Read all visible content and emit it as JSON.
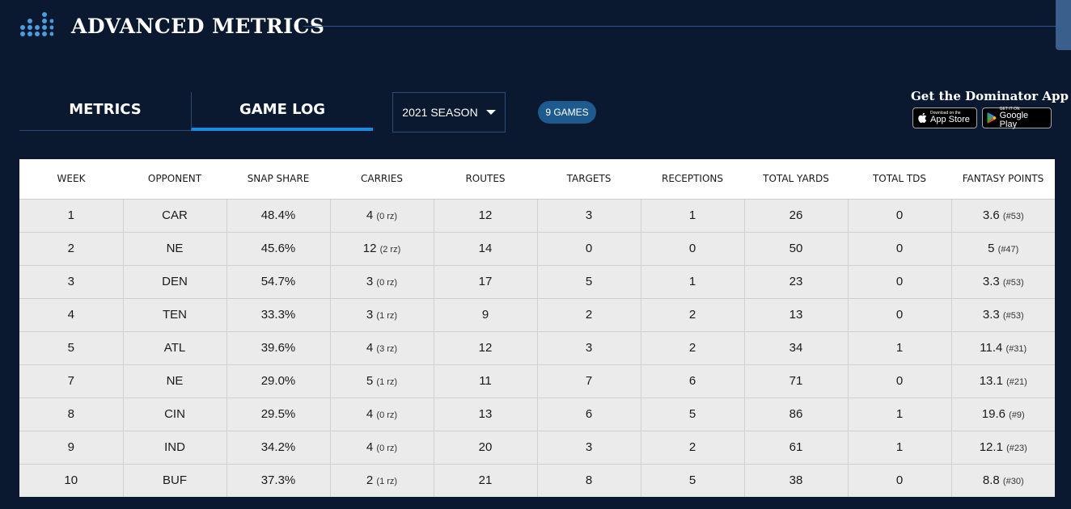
{
  "header": {
    "title": "ADVANCED METRICS",
    "logo_icon": "dot-grid-icon"
  },
  "tabs": [
    {
      "label": "METRICS",
      "active": false
    },
    {
      "label": "GAME LOG",
      "active": true
    }
  ],
  "season_select": {
    "value": "2021 SEASON"
  },
  "games_badge": "9 GAMES",
  "app_promo": {
    "title": "Get the Dominator App",
    "app_store": {
      "small": "Download on the",
      "big": "App Store"
    },
    "google_play": {
      "small": "GET IT ON",
      "big": "Google Play"
    }
  },
  "colors": {
    "background": "#0a1830",
    "accent": "#1e88e5",
    "badge": "#1d5a8e",
    "table_bg": "#ebebeb"
  },
  "table": {
    "columns": [
      "WEEK",
      "OPPONENT",
      "SNAP SHARE",
      "CARRIES",
      "ROUTES",
      "TARGETS",
      "RECEPTIONS",
      "TOTAL YARDS",
      "TOTAL TDS",
      "FANTASY POINTS"
    ],
    "rows": [
      {
        "week": "1",
        "opponent": "CAR",
        "snap": "48.4%",
        "carries": "4",
        "carries_rz": "(0 rz)",
        "routes": "12",
        "targets": "3",
        "receptions": "1",
        "yards": "26",
        "tds": "0",
        "fp": "3.6",
        "fp_rank": "(#53)"
      },
      {
        "week": "2",
        "opponent": "NE",
        "snap": "45.6%",
        "carries": "12",
        "carries_rz": "(2 rz)",
        "routes": "14",
        "targets": "0",
        "receptions": "0",
        "yards": "50",
        "tds": "0",
        "fp": "5",
        "fp_rank": "(#47)"
      },
      {
        "week": "3",
        "opponent": "DEN",
        "snap": "54.7%",
        "carries": "3",
        "carries_rz": "(0 rz)",
        "routes": "17",
        "targets": "5",
        "receptions": "1",
        "yards": "23",
        "tds": "0",
        "fp": "3.3",
        "fp_rank": "(#53)"
      },
      {
        "week": "4",
        "opponent": "TEN",
        "snap": "33.3%",
        "carries": "3",
        "carries_rz": "(1 rz)",
        "routes": "9",
        "targets": "2",
        "receptions": "2",
        "yards": "13",
        "tds": "0",
        "fp": "3.3",
        "fp_rank": "(#53)"
      },
      {
        "week": "5",
        "opponent": "ATL",
        "snap": "39.6%",
        "carries": "4",
        "carries_rz": "(3 rz)",
        "routes": "12",
        "targets": "3",
        "receptions": "2",
        "yards": "34",
        "tds": "1",
        "fp": "11.4",
        "fp_rank": "(#31)"
      },
      {
        "week": "7",
        "opponent": "NE",
        "snap": "29.0%",
        "carries": "5",
        "carries_rz": "(1 rz)",
        "routes": "11",
        "targets": "7",
        "receptions": "6",
        "yards": "71",
        "tds": "0",
        "fp": "13.1",
        "fp_rank": "(#21)"
      },
      {
        "week": "8",
        "opponent": "CIN",
        "snap": "29.5%",
        "carries": "4",
        "carries_rz": "(0 rz)",
        "routes": "13",
        "targets": "6",
        "receptions": "5",
        "yards": "86",
        "tds": "1",
        "fp": "19.6",
        "fp_rank": "(#9)"
      },
      {
        "week": "9",
        "opponent": "IND",
        "snap": "34.2%",
        "carries": "4",
        "carries_rz": "(0 rz)",
        "routes": "20",
        "targets": "3",
        "receptions": "2",
        "yards": "61",
        "tds": "1",
        "fp": "12.1",
        "fp_rank": "(#23)"
      },
      {
        "week": "10",
        "opponent": "BUF",
        "snap": "37.3%",
        "carries": "2",
        "carries_rz": "(1 rz)",
        "routes": "21",
        "targets": "8",
        "receptions": "5",
        "yards": "38",
        "tds": "0",
        "fp": "8.8",
        "fp_rank": "(#30)"
      }
    ]
  }
}
